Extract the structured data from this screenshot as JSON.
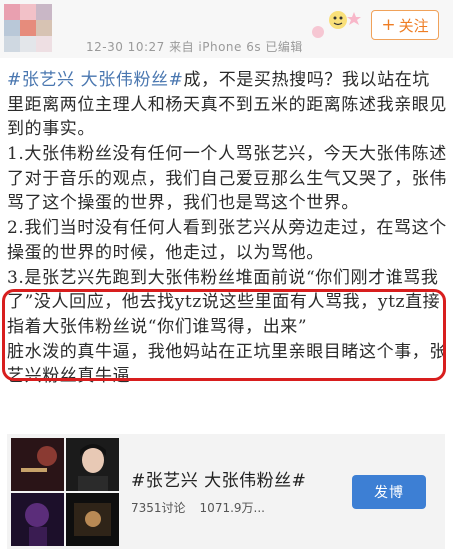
{
  "header": {
    "meta_text": "12-30 10:27 来自 iPhone 6s 已编辑",
    "follow_label": "关注",
    "follow_icon": "plus-icon",
    "colors": {
      "follow": "#ee7d24"
    }
  },
  "post": {
    "hashtag": "#张艺兴 大张伟粉丝#",
    "intro": "成，不是买热搜吗？我以站在坑里距离两位主理人和杨天真不到五米的距离陈述我亲眼见到的事实。",
    "point1": "1.大张伟粉丝没有任何一个人骂张艺兴，今天大张伟陈述了对于音乐的观点，我们自己爱豆那么生气又哭了，张伟骂了这个操蛋的世界，我们也是骂这个世界。",
    "point2": "2.我们当时没有任何人看到张艺兴从旁边走过，在骂这个操蛋的世界的时候，他走过，以为骂他。",
    "point3": "3.是张艺兴先跑到大张伟粉丝堆面前说“你们刚才谁骂我了”没人回应，他去找ytz说这些里面有人骂我，ytz直接指着大张伟粉丝说“你们谁骂得，出来”",
    "outro": "脏水泼的真牛逼，我他妈站在正坑里亲眼目睹这个事，张艺兴粉丝真牛逼",
    "highlight_color": "#d81e1e"
  },
  "topic_card": {
    "title": "#张艺兴 大张伟粉丝#",
    "discussions": "7351讨论",
    "reads": "1071.9万...",
    "post_button": "发博",
    "colors": {
      "button": "#3d7fd4"
    }
  }
}
